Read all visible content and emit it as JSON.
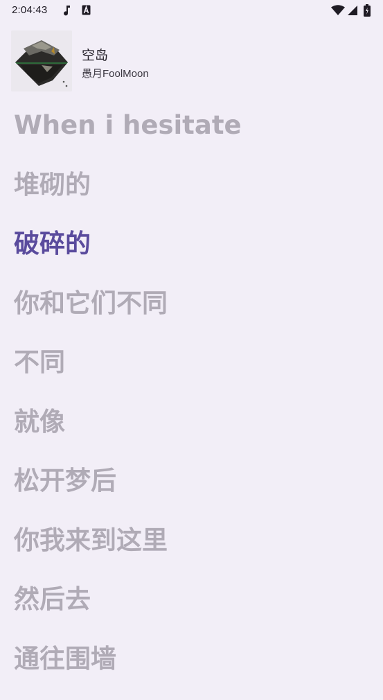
{
  "status_bar": {
    "time": "2:04:43",
    "icons": [
      "music-note-icon",
      "a-box-icon",
      "wifi-icon",
      "signal-icon",
      "battery-icon"
    ]
  },
  "now_playing": {
    "title": "空岛",
    "artist": "愚月FoolMoon"
  },
  "lyrics": {
    "current_index": 2,
    "lines": [
      "When i hesitate",
      "堆砌的",
      "破碎的",
      "你和它们不同",
      "不同",
      "就像",
      "松开梦后",
      "你我来到这里",
      "然后去",
      "通往围墙"
    ]
  },
  "colors": {
    "background": "#f2eef7",
    "current_lyric": "#5a4b9d",
    "inactive_lyric": "#b0abb6"
  }
}
